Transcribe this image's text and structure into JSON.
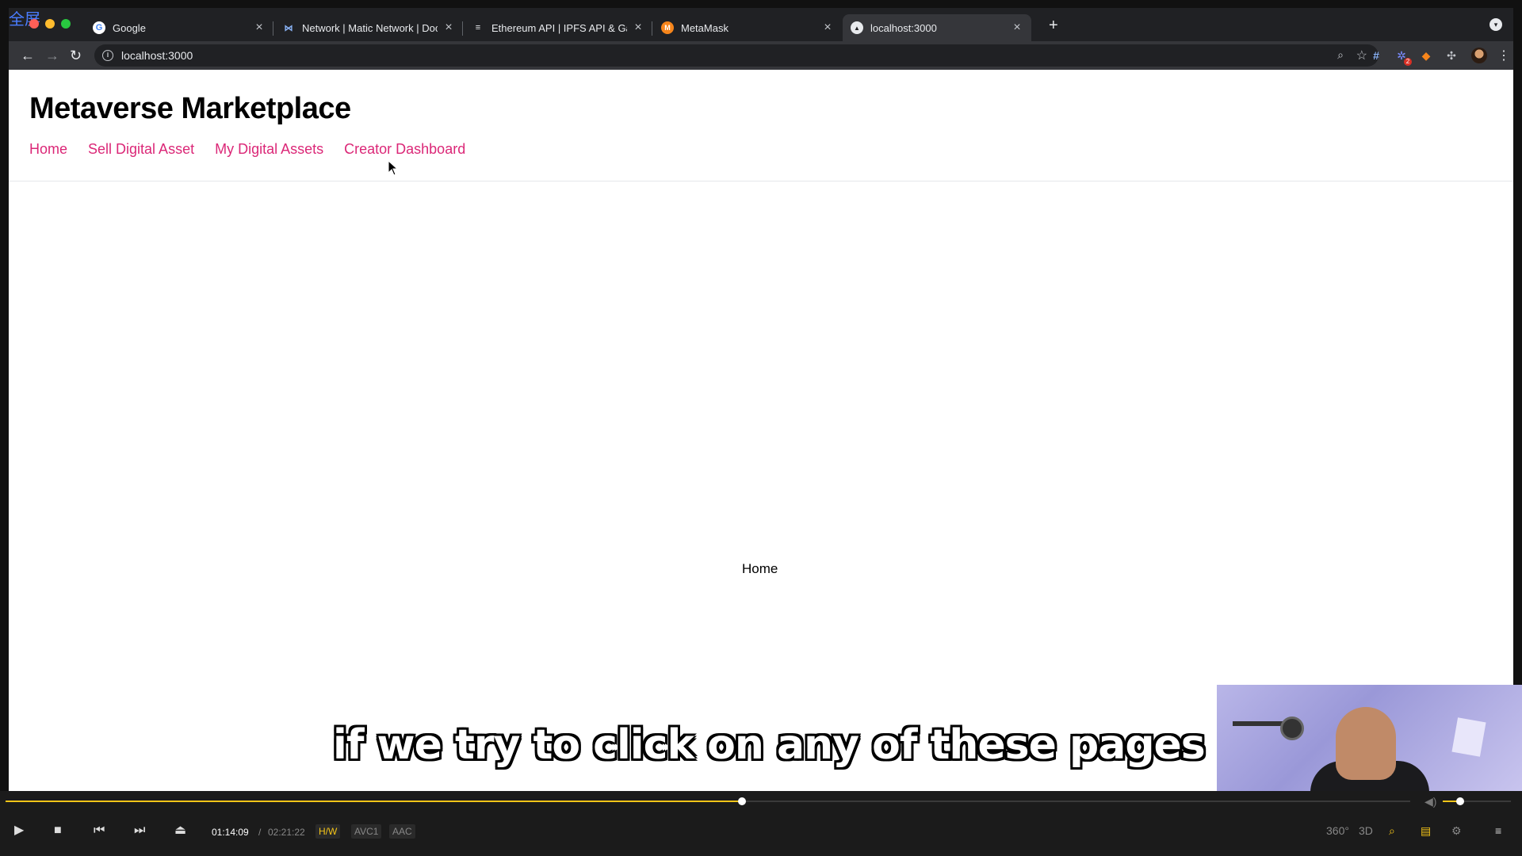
{
  "watermark": "全屏",
  "tabs": [
    {
      "label": "Google",
      "icon": "google-icon",
      "icon_char": "G",
      "icon_bg": "#ffffff",
      "icon_fg": "#4285f4"
    },
    {
      "label": "Network | Matic Network | Doc",
      "icon": "matic-icon",
      "icon_char": "⋈",
      "icon_bg": "#202124",
      "icon_fg": "#8ab4f8"
    },
    {
      "label": "Ethereum API | IPFS API & Gat",
      "icon": "infura-icon",
      "icon_char": "≡",
      "icon_bg": "#202124",
      "icon_fg": "#e8eaed"
    },
    {
      "label": "MetaMask",
      "icon": "metamask-icon",
      "icon_char": "🦊",
      "icon_bg": "#202124",
      "icon_fg": "#f6851b"
    },
    {
      "label": "localhost:3000",
      "icon": "localhost-icon",
      "icon_char": "▲",
      "icon_bg": "#e8eaed",
      "icon_fg": "#202124",
      "active": true
    }
  ],
  "omnibox": {
    "url": "localhost:3000"
  },
  "extensions": [
    "hash-extension-icon",
    "gear-extension-icon",
    "metamask-extension-icon",
    "puzzle-extensions-icon"
  ],
  "site": {
    "title": "Metaverse Marketplace",
    "nav": [
      "Home",
      "Sell Digital Asset",
      "My Digital Assets",
      "Creator Dashboard"
    ],
    "body_text": "Home"
  },
  "caption": "if we try to click on any of these pages",
  "player": {
    "current_time": "01:14:09",
    "separator": "/",
    "total_time": "02:21:22",
    "progress_fraction": 0.5245,
    "volume_fraction": 0.25,
    "codecs": [
      "H/W",
      "AVC1",
      "AAC"
    ],
    "right_controls": [
      "360°",
      "3D"
    ]
  },
  "colors": {
    "accent_nav": "#db2777",
    "player_accent": "#f5c518"
  }
}
